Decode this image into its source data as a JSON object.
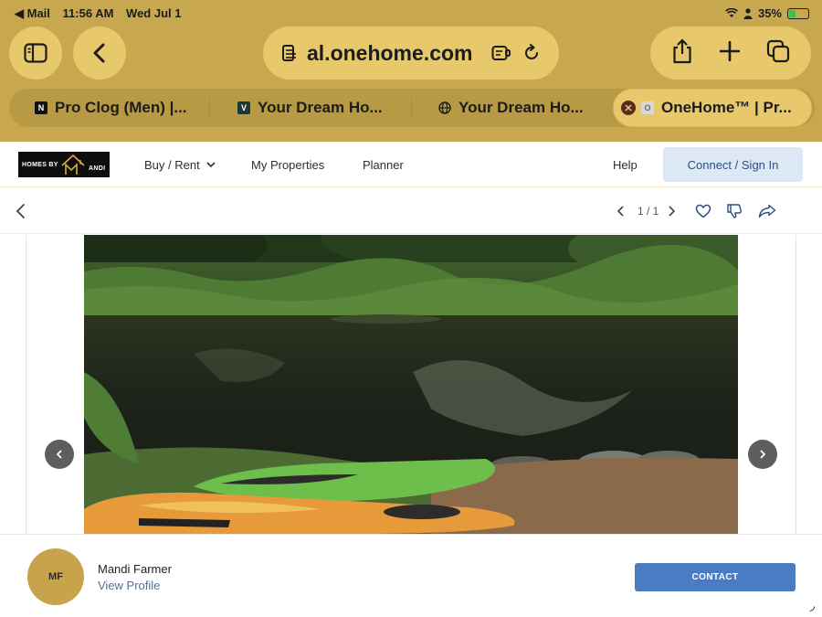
{
  "status_bar": {
    "back_app": "◀ Mail",
    "time": "11:56 AM",
    "date": "Wed Jul 1",
    "battery_text": "35%",
    "battery_level": 0.35
  },
  "browser": {
    "url_text": "al.onehome.com",
    "tabs": [
      {
        "label": "Pro Clog (Men) |...",
        "favicon": "N"
      },
      {
        "label": "Your Dream Ho...",
        "favicon": "V"
      },
      {
        "label": "Your Dream Ho...",
        "favicon": "globe"
      },
      {
        "label": "OneHome™ | Pr...",
        "favicon": "O",
        "active": true
      }
    ]
  },
  "site": {
    "logo_text": "HOMES BY",
    "logo_mark": "ANDI",
    "nav": {
      "buy_rent": "Buy / Rent",
      "my_properties": "My Properties",
      "planner": "Planner",
      "help": "Help",
      "signin": "Connect / Sign In"
    }
  },
  "toolbar": {
    "photo_counter": "1 / 1"
  },
  "agent": {
    "initials": "MF",
    "name": "Mandi Farmer",
    "profile_link": "View Profile",
    "contact_label": "CONTACT"
  },
  "colors": {
    "chrome_bg": "#c8a84e",
    "chrome_pill": "#e7c96b",
    "contact_blue": "#4a7cc4",
    "avatar_gold": "#c9a34b"
  }
}
